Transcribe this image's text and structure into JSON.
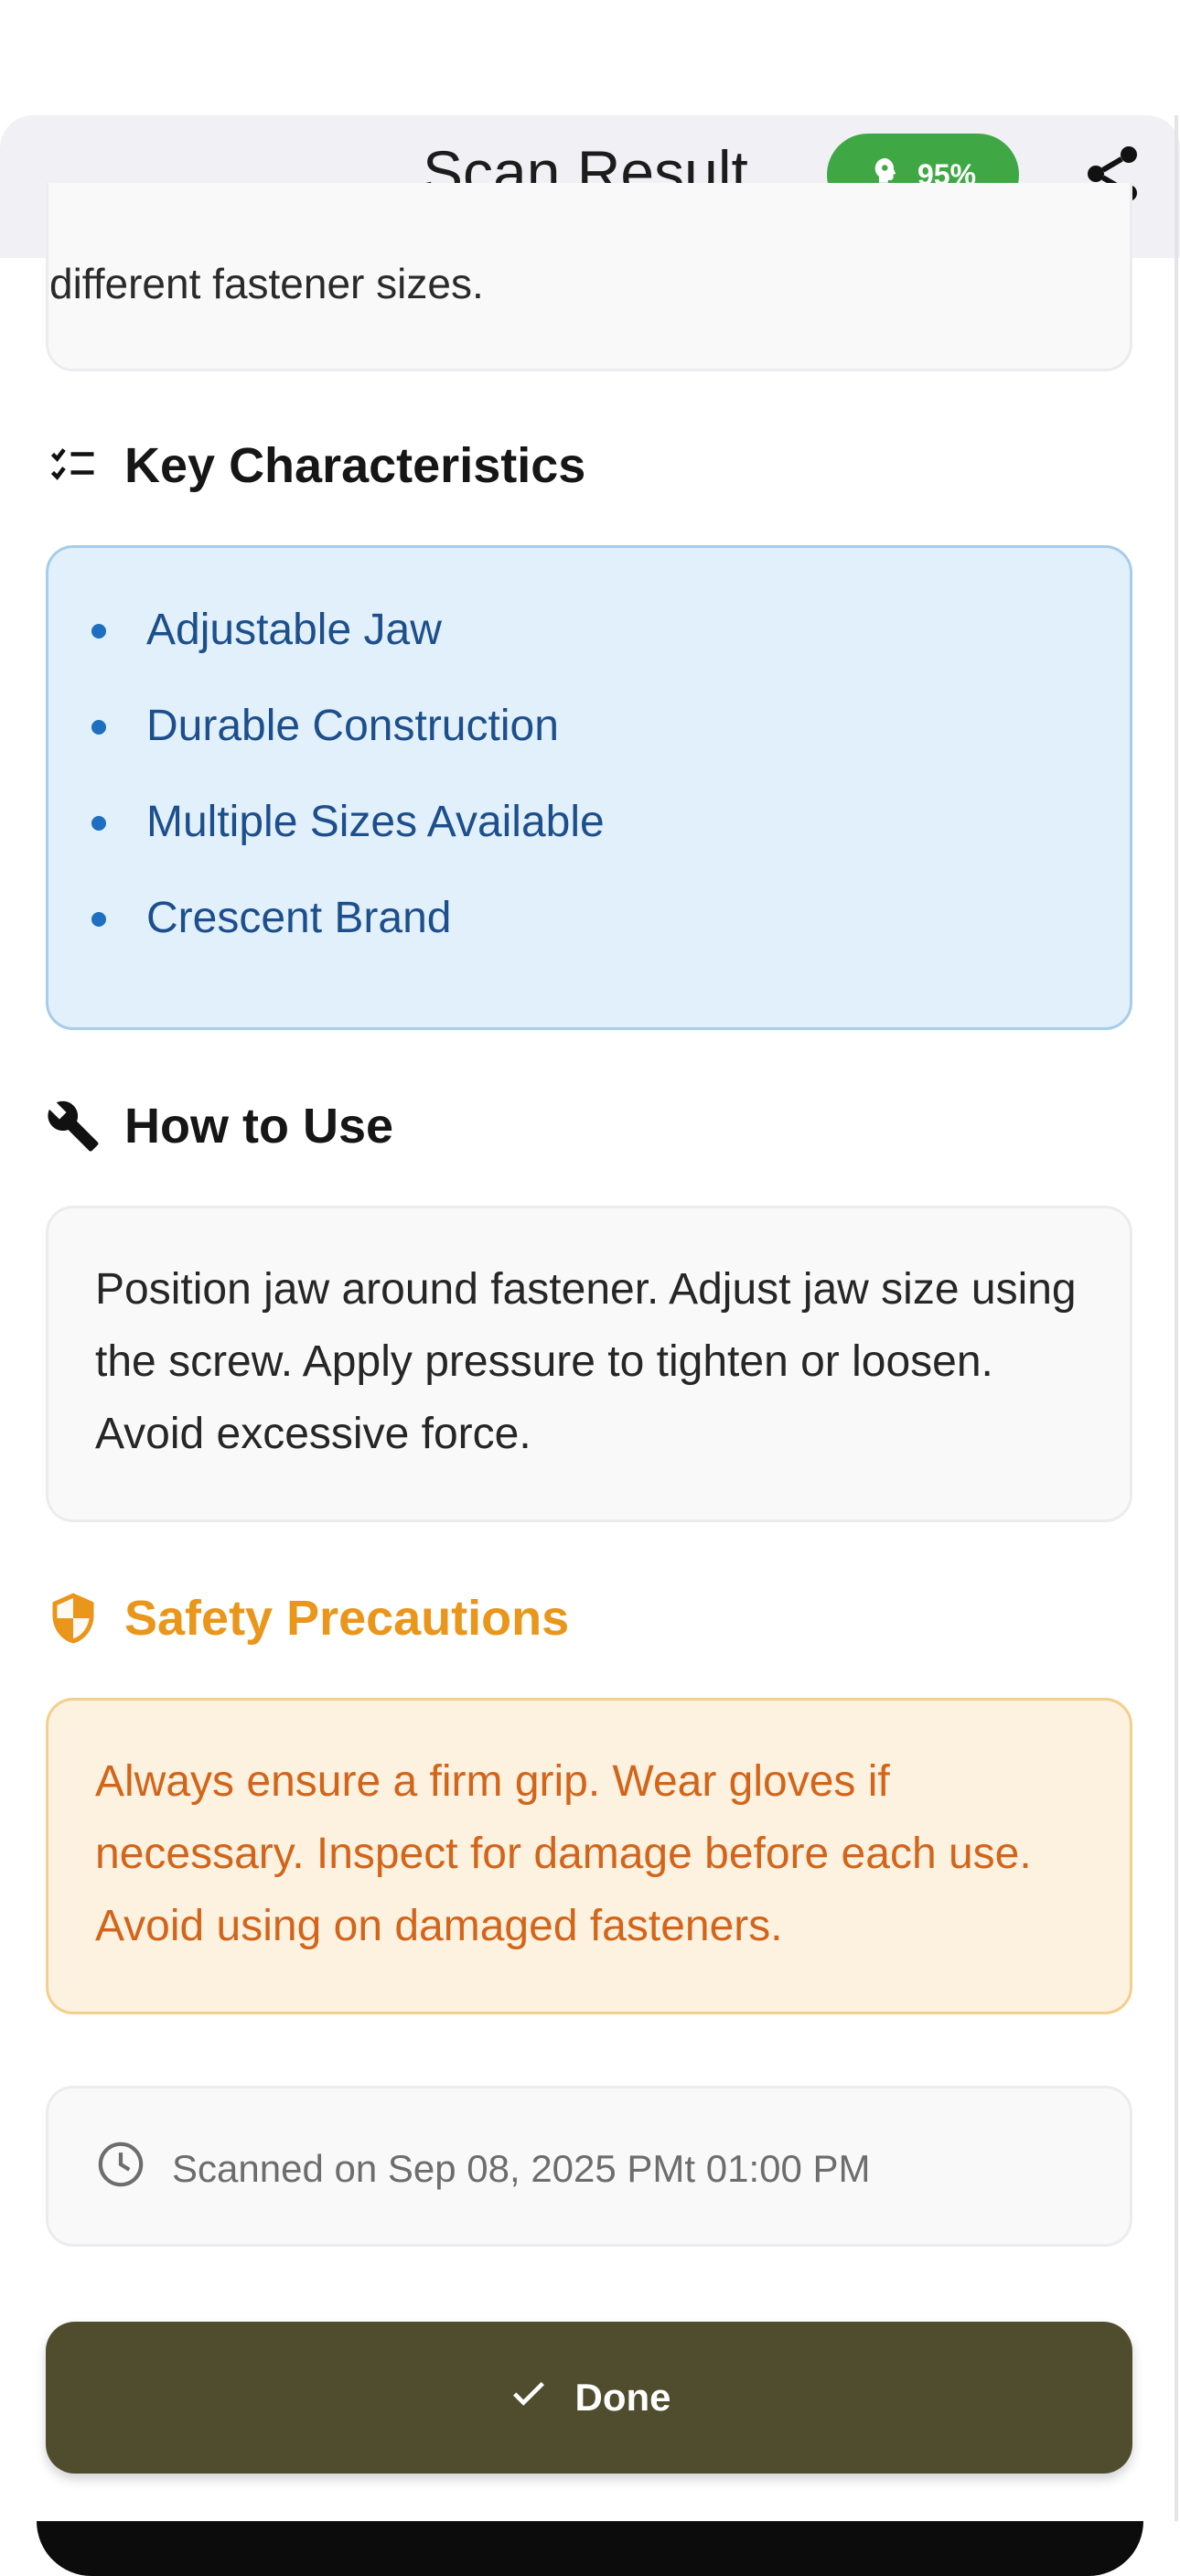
{
  "header": {
    "title": "Scan Result",
    "confidence": "95%"
  },
  "description": {
    "tail_text": "different fastener sizes."
  },
  "key_characteristics": {
    "title": "Key Characteristics",
    "items": [
      "Adjustable Jaw",
      "Durable Construction",
      "Multiple Sizes Available",
      "Crescent Brand"
    ]
  },
  "how_to_use": {
    "title": "How to Use",
    "text": "Position jaw around fastener. Adjust jaw size using the screw. Apply pressure to tighten or loosen. Avoid excessive force."
  },
  "safety": {
    "title": "Safety Precautions",
    "text": "Always ensure a firm grip. Wear gloves if necessary. Inspect for damage before each use. Avoid using on damaged fasteners."
  },
  "scan_info": {
    "text": "Scanned on Sep 08, 2025 PMt 01:00 PM"
  },
  "actions": {
    "done_label": "Done"
  },
  "colors": {
    "badge": "#3fa845",
    "done_button": "#4f4d2d",
    "info_blue": "#1c4f8c",
    "warning_orange": "#d2651a",
    "warning_heading": "#e9961a"
  },
  "icons": {
    "badge": "brain-icon",
    "share": "share-icon",
    "characteristics": "checklist-icon",
    "how_to_use": "wrench-icon",
    "safety": "shield-icon",
    "scan_time": "clock-icon",
    "done": "check-icon"
  }
}
